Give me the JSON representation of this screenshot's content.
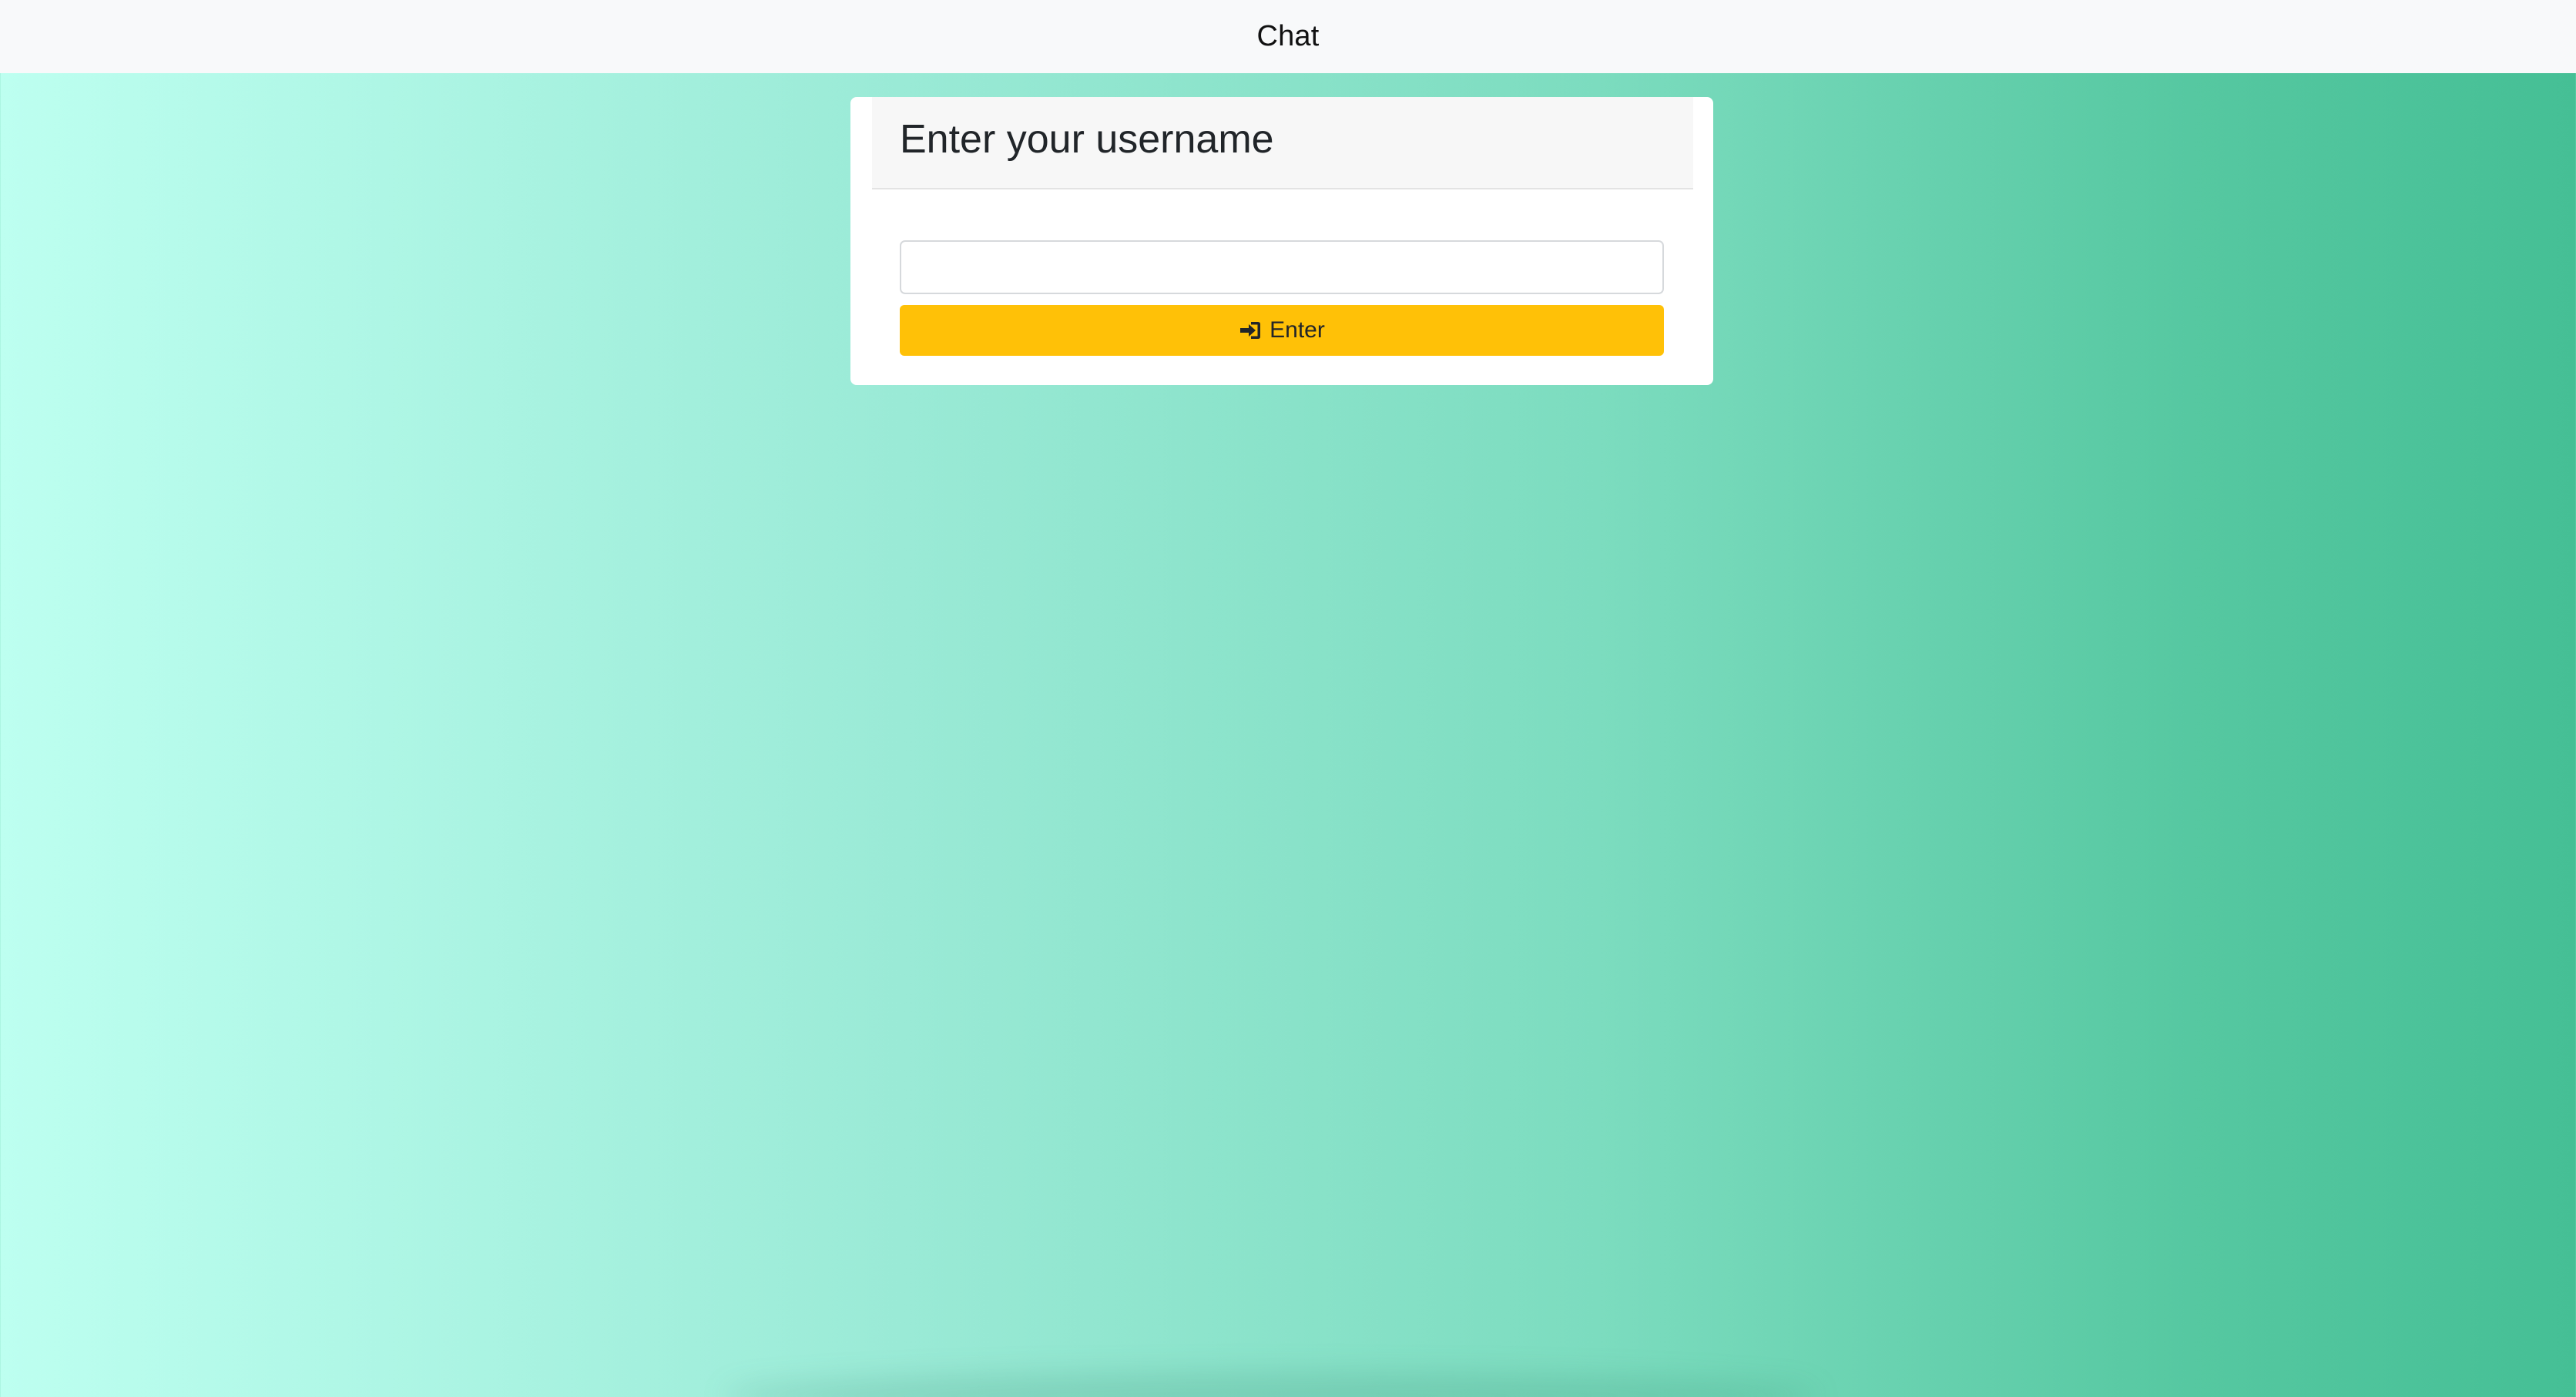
{
  "navbar": {
    "brand": "Chat"
  },
  "login_card": {
    "title": "Enter your username",
    "username_input": {
      "value": "",
      "placeholder": ""
    },
    "enter_button": {
      "label": "Enter",
      "icon": "sign-in-icon"
    }
  },
  "colors": {
    "navbar_bg": "#f8f9fa",
    "gradient_start": "#bdfff0",
    "gradient_end": "#45bf95",
    "button_bg": "#ffc107",
    "card_bg": "#ffffff",
    "card_header_bg": "#f7f7f7"
  }
}
